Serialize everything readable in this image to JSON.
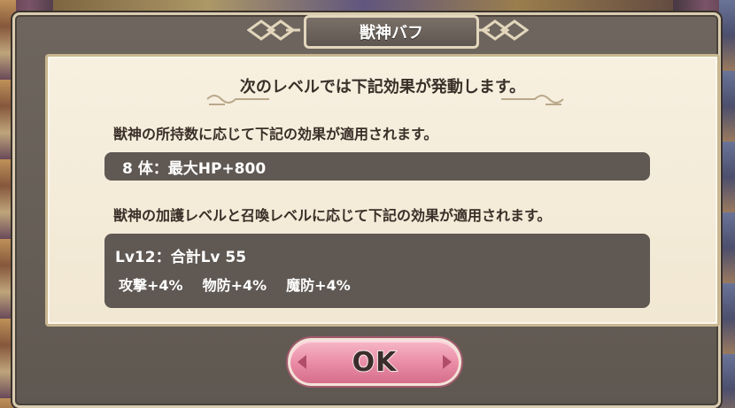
{
  "dialog": {
    "title": "獣神バフ",
    "heading": "次のレベルでは下記効果が発動します。",
    "section_a_text": "獣神の所持数に応じて下記の効果が適用されます。",
    "row_a": "8 体：最大HP+800",
    "section_b_text": "獣神の加護レベルと召喚レベルに応じて下記の効果が適用されます。",
    "row_b_line1": "Lv12：合計Lv 55",
    "row_b_stats": [
      "攻撃+4%",
      "物防+4%",
      "魔防+4%"
    ],
    "ok_label": "OK"
  },
  "colors": {
    "frame": "#6e665e",
    "parchment": "#f4ecda",
    "row_bg": "#5f5853",
    "ok_button": "#e98aa4"
  },
  "icons": [
    "title-ornament-left-icon",
    "title-ornament-right-icon",
    "heading-ornament-icon",
    "left-arrow-icon",
    "right-arrow-icon"
  ]
}
